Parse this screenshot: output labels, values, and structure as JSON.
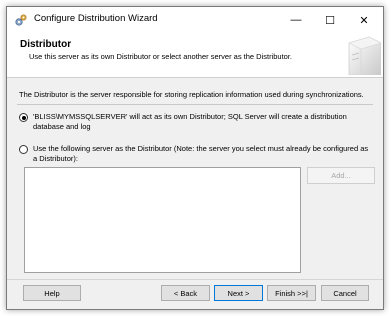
{
  "window": {
    "title": "Configure Distribution Wizard",
    "controls": {
      "minimize": "—",
      "maximize": "☐",
      "close": "✕"
    }
  },
  "header": {
    "title": "Distributor",
    "subtitle": "Use this server as its own Distributor or select another server as the Distributor."
  },
  "intro": "The Distributor is the server responsible for storing replication information used during synchronizations.",
  "options": [
    {
      "label": "'BLISS\\MYMSSQLSERVER' will act as its own Distributor; SQL Server will create a distribution database and log",
      "selected": true
    },
    {
      "label": "Use the following server as the Distributor (Note: the server you select must already be configured as a Distributor):",
      "selected": false
    }
  ],
  "server_list": {
    "items": []
  },
  "add_button": {
    "label": "Add...",
    "enabled": false
  },
  "footer": {
    "help": "Help",
    "back": "< Back",
    "next": "Next >",
    "finish": "Finish >>|",
    "cancel": "Cancel"
  },
  "icons": {
    "app": "wizard-gear-icon",
    "header_graphic": "server-graphic-icon"
  },
  "colors": {
    "focus_border": "#0078d7",
    "dialog_bg": "#f0f0f0",
    "header_bg": "#ffffff"
  }
}
